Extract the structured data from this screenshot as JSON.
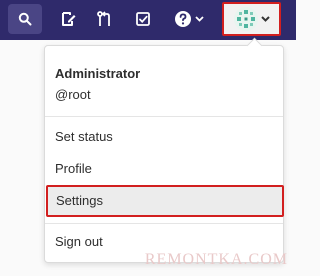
{
  "navbar": {
    "background": "#2f2a6b",
    "icons": [
      "search-icon",
      "snippet-icon",
      "merge-request-icon",
      "todo-icon",
      "help-icon",
      "chevron-down-icon",
      "avatar",
      "chevron-down-icon"
    ]
  },
  "user_menu": {
    "name": "Administrator",
    "handle": "@root",
    "items": [
      {
        "label": "Set status"
      },
      {
        "label": "Profile"
      },
      {
        "label": "Settings",
        "highlighted": true
      },
      {
        "label": "Sign out"
      }
    ]
  },
  "highlight_color": "#d21f1f",
  "watermark": "REMONTKA.COM"
}
